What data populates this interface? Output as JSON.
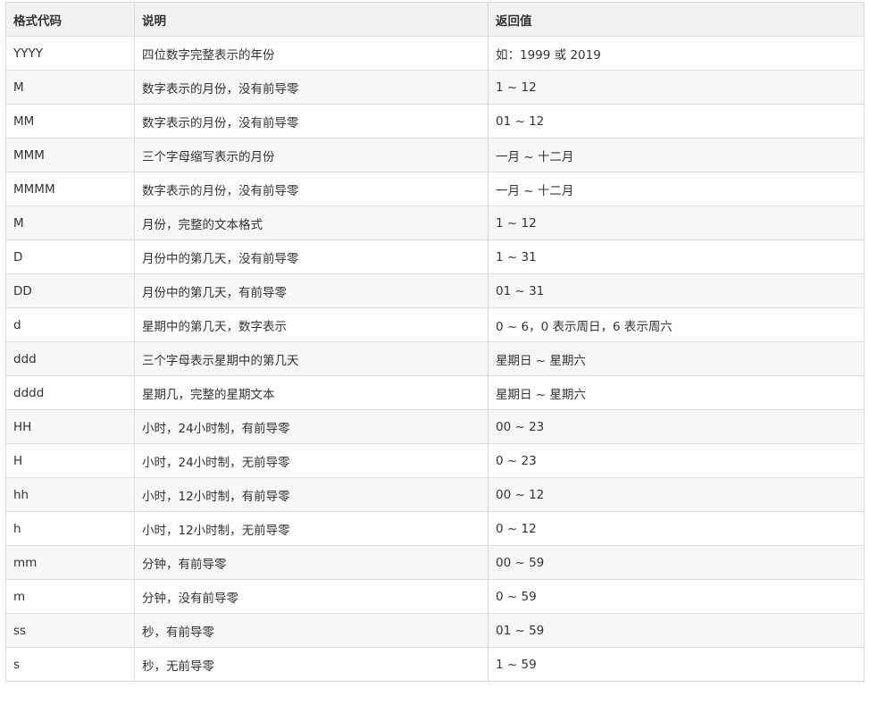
{
  "table": {
    "headers": [
      "格式代码",
      "说明",
      "返回值"
    ],
    "rows": [
      {
        "code": "YYYY",
        "desc": "四位数字完整表示的年份",
        "value": "如：1999 或 2019"
      },
      {
        "code": "M",
        "desc": "数字表示的月份，没有前导零",
        "value": "1 ~ 12"
      },
      {
        "code": "MM",
        "desc": "数字表示的月份，没有前导零",
        "value": "01 ~ 12"
      },
      {
        "code": "MMM",
        "desc": "三个字母缩写表示的月份",
        "value": "一月 ~ 十二月"
      },
      {
        "code": "MMMM",
        "desc": "数字表示的月份，没有前导零",
        "value": "一月 ~ 十二月"
      },
      {
        "code": "M",
        "desc": "月份，完整的文本格式",
        "value": "1 ~ 12"
      },
      {
        "code": "D",
        "desc": "月份中的第几天，没有前导零",
        "value": "1 ~ 31"
      },
      {
        "code": "DD",
        "desc": "月份中的第几天，有前导零",
        "value": "01 ~ 31"
      },
      {
        "code": "d",
        "desc": "星期中的第几天，数字表示",
        "value": "0 ~ 6，0 表示周日，6 表示周六"
      },
      {
        "code": "ddd",
        "desc": "三个字母表示星期中的第几天",
        "value": "星期日 ~ 星期六"
      },
      {
        "code": "dddd",
        "desc": "星期几，完整的星期文本",
        "value": "星期日 ~ 星期六"
      },
      {
        "code": "HH",
        "desc": "小时，24小时制，有前导零",
        "value": "00 ~ 23"
      },
      {
        "code": "H",
        "desc": "小时，24小时制，无前导零",
        "value": "0 ~ 23"
      },
      {
        "code": "hh",
        "desc": "小时，12小时制，有前导零",
        "value": "00 ~ 12"
      },
      {
        "code": "h",
        "desc": "小时，12小时制，无前导零",
        "value": "0 ~ 12"
      },
      {
        "code": "mm",
        "desc": "分钟，有前导零",
        "value": "00 ~ 59"
      },
      {
        "code": "m",
        "desc": "分钟，没有前导零",
        "value": "0 ~ 59"
      },
      {
        "code": "ss",
        "desc": "秒，有前导零",
        "value": "01 ~ 59"
      },
      {
        "code": "s",
        "desc": "秒，无前导零",
        "value": "1 ~ 59"
      }
    ]
  },
  "colors": {
    "header_bg": "#f2f2f2",
    "row_alt_bg": "#f7f7f7",
    "border": "#dcdcdc",
    "text": "#333333"
  }
}
